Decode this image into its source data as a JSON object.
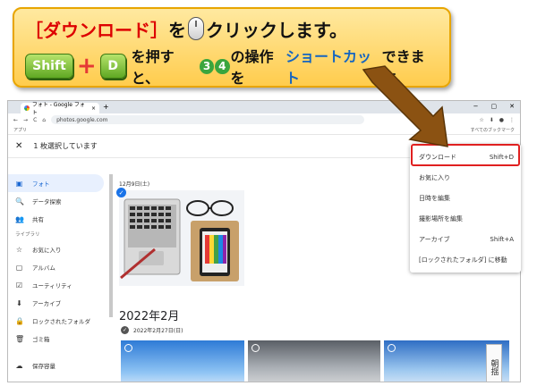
{
  "callout": {
    "line1_bracket_open": "［",
    "line1_highlight": "ダウンロード",
    "line1_bracket_close": "］",
    "line1_after_bracket": " を",
    "line1_rest": "クリックします。",
    "key1": "Shift",
    "key_plus": "+",
    "key2": "D",
    "line2_part1": "を押すと、",
    "step3": "3",
    "step4": "4",
    "line2_part2": "の操作を",
    "line2_highlight": "ショートカット",
    "line2_part3": "できます。"
  },
  "browser": {
    "tab_title": "フォト - Google フォト",
    "tab_close": "×",
    "new_tab": "+",
    "url": "photos.google.com",
    "bookmark": "アプリ",
    "bookmark_folder": "すべてのブックマーク",
    "window_min": "−",
    "window_max": "▢",
    "window_close": "✕",
    "back": "←",
    "forward": "→",
    "reload": "C",
    "home": "⌂"
  },
  "app": {
    "selection_text": "1 枚選択しています",
    "close": "✕"
  },
  "sidebar": {
    "items": [
      {
        "label": "フォト",
        "icon": "▣"
      },
      {
        "label": "データ探索",
        "icon": "🔍"
      },
      {
        "label": "共有",
        "icon": "👥"
      }
    ],
    "library_label": "ライブラリ",
    "library_items": [
      {
        "label": "お気に入り",
        "icon": "☆"
      },
      {
        "label": "アルバム",
        "icon": "▢"
      },
      {
        "label": "ユーティリティ",
        "icon": "☑"
      },
      {
        "label": "アーカイブ",
        "icon": "⬇"
      },
      {
        "label": "ロックされたフォルダ",
        "icon": "🔒"
      },
      {
        "label": "ゴミ箱",
        "icon": "🗑"
      }
    ],
    "storage_label": "保存容量",
    "storage_icon": "☁"
  },
  "main": {
    "date1": "12月9日(土)",
    "month_heading": "2022年2月",
    "date2": "2022年2月27日(日)",
    "check": "✓",
    "kanji": "朝揺"
  },
  "menu": {
    "items": [
      {
        "label": "ダウンロード",
        "shortcut": "Shift+D"
      },
      {
        "label": "お気に入り",
        "shortcut": ""
      },
      {
        "label": "日時を編集",
        "shortcut": ""
      },
      {
        "label": "撮影場所を編集",
        "shortcut": ""
      },
      {
        "label": "アーカイブ",
        "shortcut": "Shift+A"
      },
      {
        "label": "[ロックされたフォルダ] に移動",
        "shortcut": ""
      }
    ]
  },
  "colors": {
    "callout_bg": "#ffcc4d",
    "highlight_red": "#e02020",
    "accent_blue": "#1a73e8",
    "key_green": "#5fa823"
  }
}
